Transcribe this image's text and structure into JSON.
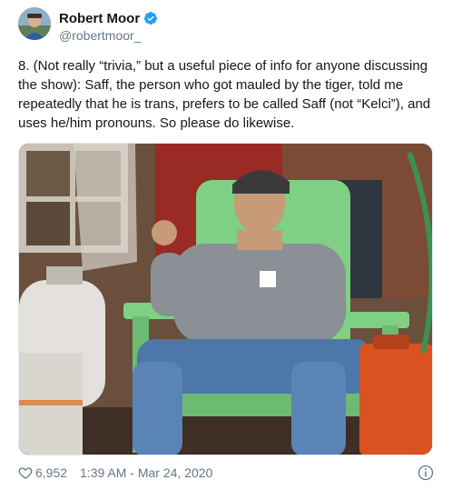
{
  "author": {
    "display_name": "Robert Moor",
    "handle": "@robertmoor_",
    "verified": true,
    "avatar_icon": "avatar-photo"
  },
  "tweet": {
    "text": "8. (Not really “trivia,” but a useful piece of info for anyone discussing the show): Saff, the person who got mauled by the tiger, told me repeatedly that he is trans, prefers to be called Saff (not “Kelci”), and uses he/him pronouns. So please do likewise."
  },
  "media": {
    "description_icon": "photo"
  },
  "footer": {
    "likes": "6,952",
    "timestamp": "1:39 AM - Mar 24, 2020",
    "heart_icon": "heart-icon",
    "info_icon": "info-icon"
  },
  "colors": {
    "verified_blue": "#1da1f2",
    "muted_text": "#657786",
    "primary_text": "#14171a"
  }
}
